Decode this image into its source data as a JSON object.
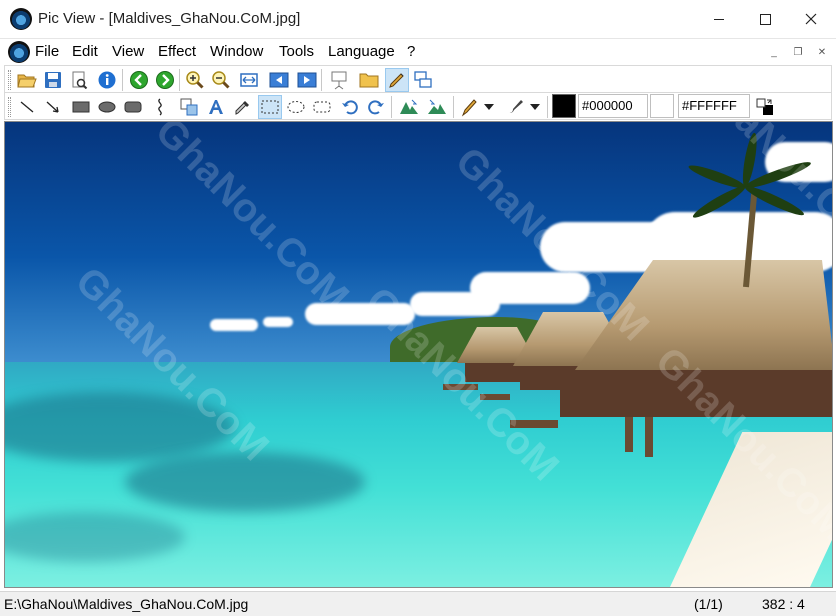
{
  "window": {
    "title": "Pic View - [Maldives_GhaNou.CoM.jpg]",
    "minimize_glyph": "─",
    "maximize_glyph": "☐",
    "close_glyph": "✕"
  },
  "menu": {
    "items": [
      "File",
      "Edit",
      "View",
      "Effect",
      "Window",
      "Tools",
      "Language",
      "?"
    ],
    "mdi_minimize": "_",
    "mdi_restore": "❐",
    "mdi_close": "✕"
  },
  "toolbar1": {
    "icons": [
      "open-folder-icon",
      "save-icon",
      "print-preview-icon",
      "info-icon",
      "previous-icon",
      "next-icon",
      "zoom-in-icon",
      "zoom-out-icon",
      "fit-width-icon",
      "first-image-icon",
      "last-image-icon",
      "slideshow-icon",
      "browse-folder-icon",
      "draw-mode-icon",
      "windows-icon"
    ],
    "active": "draw-mode-icon"
  },
  "toolbar2": {
    "icons": [
      "line-icon",
      "arrow-line-icon",
      "rectangle-icon",
      "ellipse-icon",
      "rounded-rect-icon",
      "freehand-icon",
      "clone-icon",
      "text-icon",
      "eyedropper-icon",
      "rect-select-icon",
      "ellipse-select-icon",
      "rounded-select-icon",
      "undo-icon",
      "redo-icon",
      "flip-horizontal-icon",
      "flip-vertical-icon",
      "pen-icon",
      "brush-icon",
      "swap-colors-icon"
    ],
    "active": "rect-select-icon",
    "foreground_color": "#000000",
    "foreground_label": "#000000",
    "background_color": "#FFFFFF",
    "background_label": "#FFFFFF"
  },
  "watermark_text": "GhaNou.CoM",
  "status": {
    "path": "E:\\GhaNou\\Maldives_GhaNou.CoM.jpg",
    "index": "(1/1)",
    "zoom": "382 : 4"
  }
}
